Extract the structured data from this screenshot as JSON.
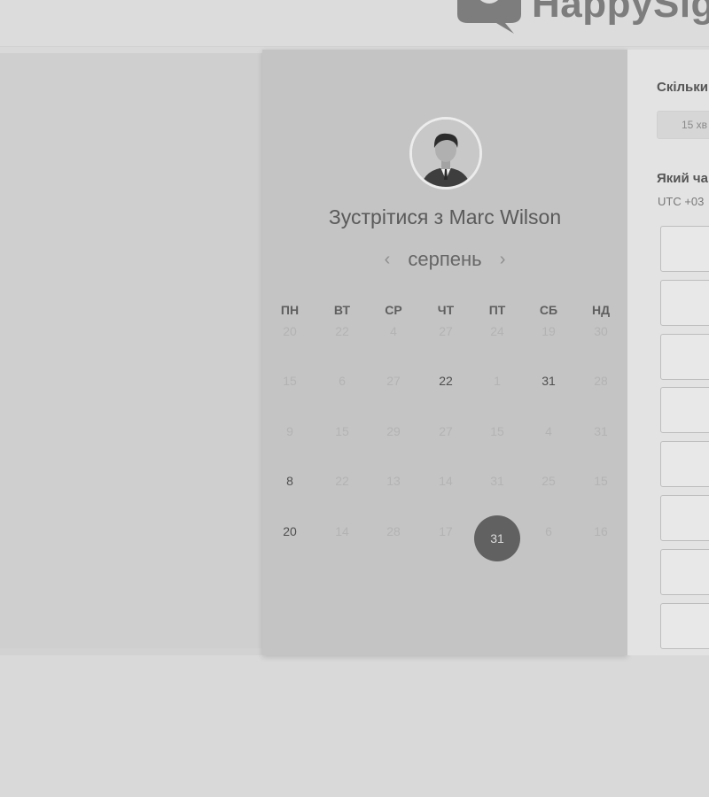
{
  "brand": {
    "name": "HappySig",
    "logo_icon": "speech-bubble-heart-icon"
  },
  "calendar": {
    "title": "Зустрітися з Marc Wilson",
    "month": "серпень",
    "prev_icon": "chevron-left-icon",
    "next_icon": "chevron-right-icon",
    "weekdays": [
      "ПН",
      "ВТ",
      "СР",
      "ЧТ",
      "ПТ",
      "СБ",
      "НД"
    ],
    "weeks": [
      [
        "20",
        "22",
        "4",
        "27",
        "24",
        "19",
        "30"
      ],
      [
        "15",
        "6",
        "27",
        "22",
        "1",
        "31",
        "28"
      ],
      [
        "9",
        "15",
        "29",
        "27",
        "15",
        "4",
        "31"
      ],
      [
        "8",
        "22",
        "13",
        "14",
        "31",
        "25",
        "15"
      ],
      [
        "20",
        "14",
        "28",
        "17",
        "31",
        "6",
        "16"
      ]
    ],
    "available": [
      [
        1,
        3
      ],
      [
        1,
        5
      ],
      [
        3,
        0
      ],
      [
        4,
        0
      ]
    ],
    "selected": [
      4,
      4
    ]
  },
  "booking": {
    "duration_label": "Скільки",
    "duration_value": "15 хв",
    "time_label": "Який ча",
    "timezone": "UTC +03",
    "slot_count": 8
  },
  "colors": {
    "selected_day": "#616161",
    "card_bg": "#c4c4c4",
    "panel_bg": "#e3e3e3"
  }
}
